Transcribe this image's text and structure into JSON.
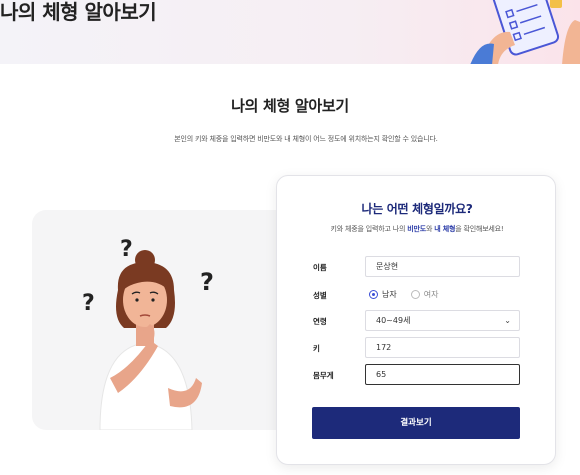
{
  "banner": {
    "title": "나의 체형 알아보기"
  },
  "page": {
    "title": "나의 체형 알아보기",
    "description": "본인의 키와 체중을 입력하면 비만도와 내 체형이 어느 정도에 위치하는지 확인할 수 있습니다."
  },
  "card": {
    "title": "나는 어떤 체형일까요?",
    "subtitle_pre": "키와 체중을 입력하고 나의 ",
    "subtitle_hl1": "비만도",
    "subtitle_mid": "와 ",
    "subtitle_hl2": "내 체형",
    "subtitle_post": "을 확인해보세요!",
    "name_label": "이름",
    "name_value": "문상현",
    "gender_label": "성별",
    "gender_male": "남자",
    "gender_female": "여자",
    "gender_selected": "남자",
    "age_label": "연령",
    "age_value": "40~49세",
    "height_label": "키",
    "height_value": "172",
    "weight_label": "몸무게",
    "weight_value": "65",
    "submit_label": "결과보기"
  },
  "colors": {
    "primary": "#1d2a7a",
    "accent": "#3b4fd6"
  },
  "icons": [
    "question-mark-icon",
    "chevron-down-icon",
    "checklist-illustration"
  ]
}
